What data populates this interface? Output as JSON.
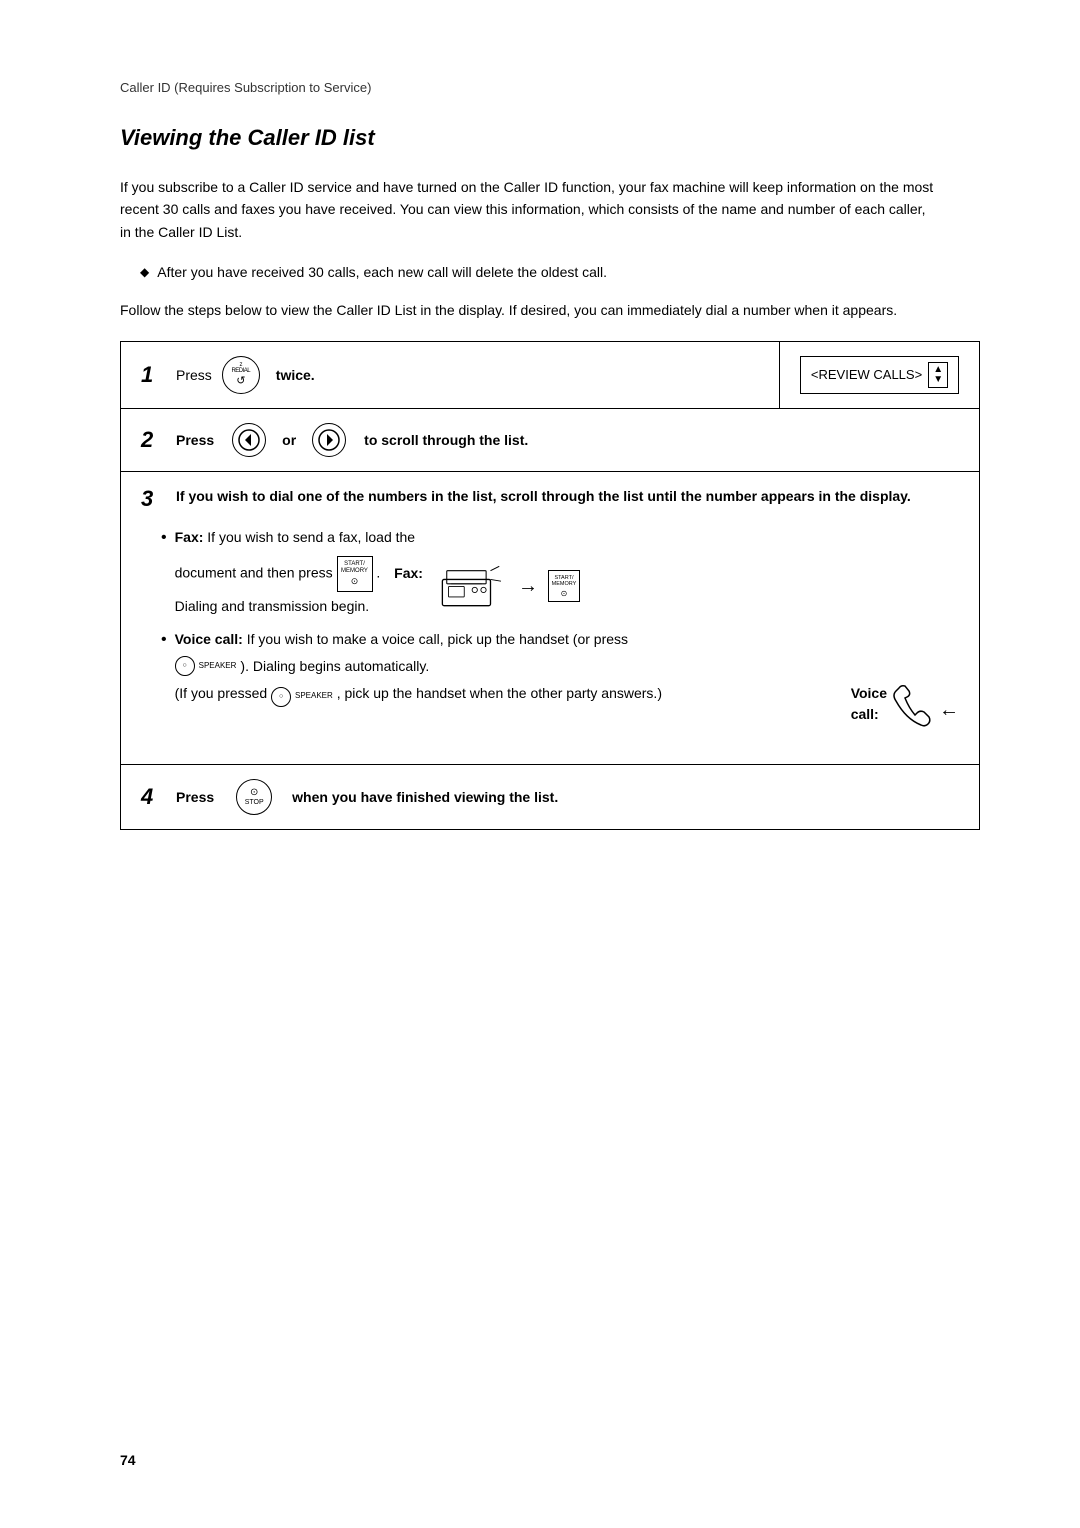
{
  "breadcrumb": "Caller ID (Requires Subscription to Service)",
  "section_title": "Viewing the Caller ID list",
  "intro_paragraph": "If you subscribe to a Caller ID service and have turned on the Caller ID function, your fax machine will keep information on the most recent 30 calls and faxes you have received. You can view this information, which consists of the name and number of each caller, in the Caller ID List.",
  "note_bullet": "After you have received 30 calls, each new call will delete the oldest call.",
  "follow_text": "Follow the steps below to view the Caller ID List in the display. If desired, you can immediately dial a number when it appears.",
  "steps": {
    "step1": {
      "number": "1",
      "press_label": "Press",
      "button_label": "REDIAL",
      "button_sublabel": "z",
      "twice_label": "twice.",
      "side_label": "<REVIEW CALLS>",
      "side_arrows": "▲▼"
    },
    "step2": {
      "number": "2",
      "press_label": "Press",
      "or_label": "or",
      "scroll_label": "to  scroll through the list."
    },
    "step3": {
      "number": "3",
      "header_bold": "If you wish to dial one of the numbers in the list, scroll through the list until the number appears in the display.",
      "fax_bullet_label": "Fax:",
      "fax_bullet_intro": "If you wish to send a fax, load the",
      "fax_doc_text": "document and then press",
      "fax_dot": ".",
      "fax_label": "Fax:",
      "fax_dialing": "Dialing and transmission begin.",
      "voice_bullet_intro": "Voice call:",
      "voice_bullet_text": "If you wish to make a voice call, pick up the handset (or press",
      "speaker_label": "SPEAKER",
      "voice_dialing": "). Dialing begins automatically.",
      "voice_if_pressed": "(If you pressed",
      "voice_speaker2": "SPEAKER",
      "voice_pickup": ", pick up the handset when the other party answers.)",
      "voice_label": "Voice\ncall:"
    },
    "step4": {
      "number": "4",
      "press_label": "Press",
      "button_label": "STOP",
      "action_label": "when you have finished viewing the list."
    }
  },
  "page_number": "74"
}
